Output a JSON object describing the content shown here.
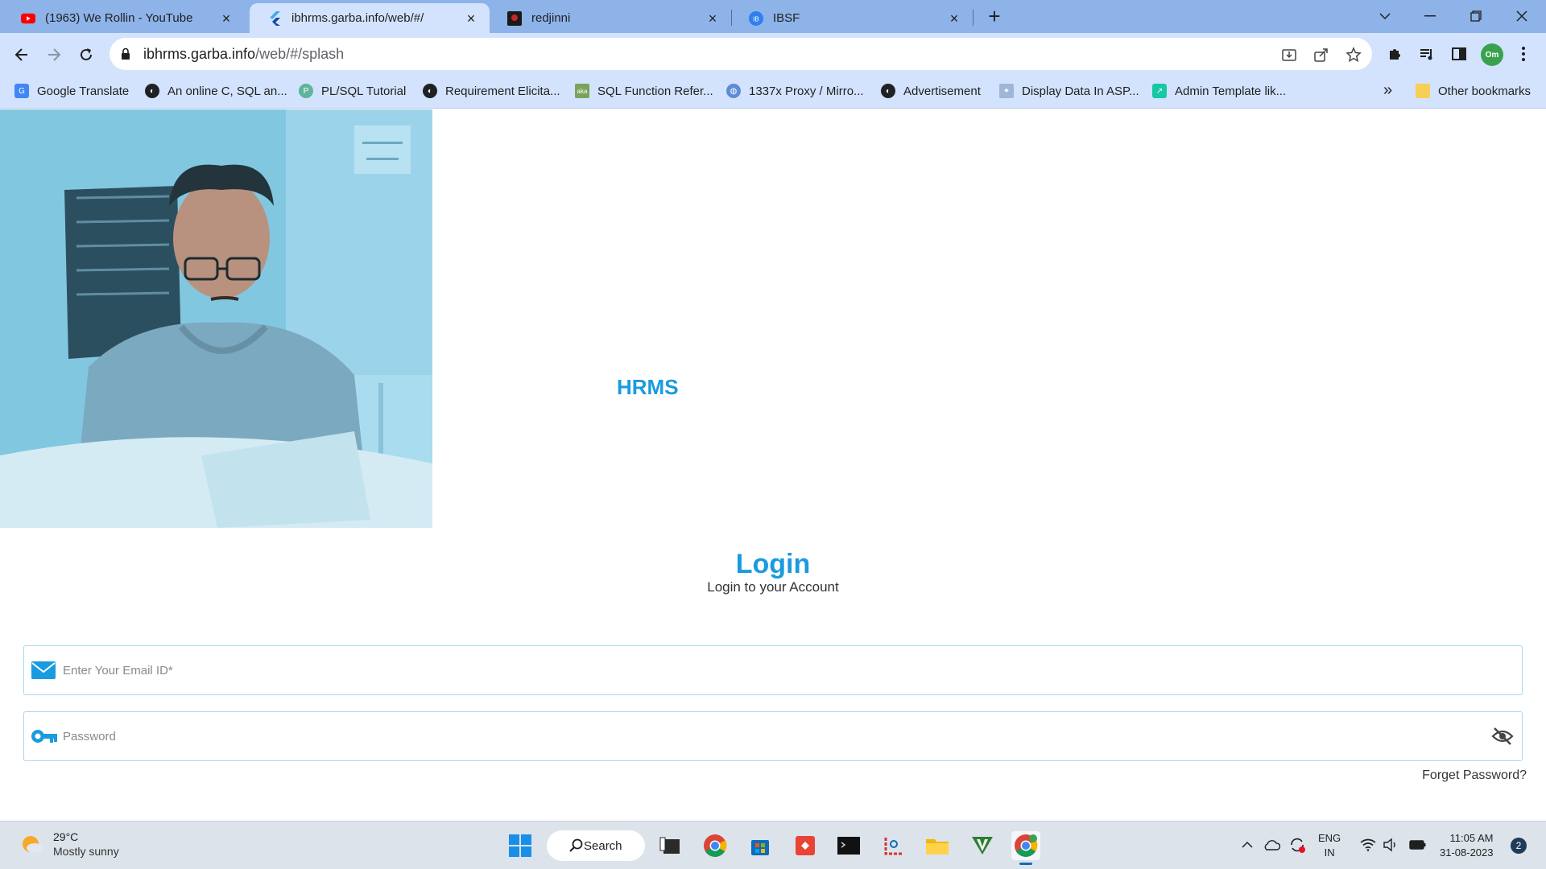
{
  "browser": {
    "tabs": [
      {
        "title": "(1963) We Rollin - YouTube",
        "favicon": "youtube-icon"
      },
      {
        "title": "ibhrms.garba.info/web/#/",
        "favicon": "flutter-icon",
        "active": true
      },
      {
        "title": "redjinni",
        "favicon": "redjinni-icon"
      },
      {
        "title": "IBSF",
        "favicon": "ibsf-icon"
      }
    ],
    "url_host": "ibhrms.garba.info",
    "url_path": "/web/#/splash",
    "bookmarks": [
      {
        "label": "Google Translate",
        "icon": "google-translate-icon",
        "color": "#4285f4"
      },
      {
        "label": "An online C, SQL an...",
        "icon": "globe-icon",
        "color": "#202124"
      },
      {
        "label": "PL/SQL Tutorial",
        "icon": "p-icon",
        "color": "#5fb49c"
      },
      {
        "label": "Requirement Elicita...",
        "icon": "globe-icon",
        "color": "#202124"
      },
      {
        "label": "SQL Function Refer...",
        "icon": "aka-icon",
        "color": "#7aa35a"
      },
      {
        "label": "1337x Proxy / Mirro...",
        "icon": "globe-icon",
        "color": "#5f8cd6"
      },
      {
        "label": "Advertisement",
        "icon": "globe-icon",
        "color": "#202124"
      },
      {
        "label": "Display Data In ASP...",
        "icon": "puzzle-icon",
        "color": "#9fb6d6"
      },
      {
        "label": "Admin Template lik...",
        "icon": "chart-icon",
        "color": "#16c8a3"
      }
    ],
    "other_bookmarks": "Other bookmarks",
    "profile_initials": "Om"
  },
  "page": {
    "brand": "HRMS",
    "login_title": "Login",
    "login_subtitle": "Login to your Account",
    "email_placeholder": "Enter Your Email ID*",
    "password_placeholder": "Password",
    "forgot_password": "Forget Password?",
    "accent_color": "#1a9be0"
  },
  "taskbar": {
    "weather_temp": "29°C",
    "weather_condition": "Mostly sunny",
    "search_label": "Search",
    "lang_top": "ENG",
    "lang_bottom": "IN",
    "time": "11:05 AM",
    "date": "31-08-2023",
    "notification_count": "2"
  }
}
